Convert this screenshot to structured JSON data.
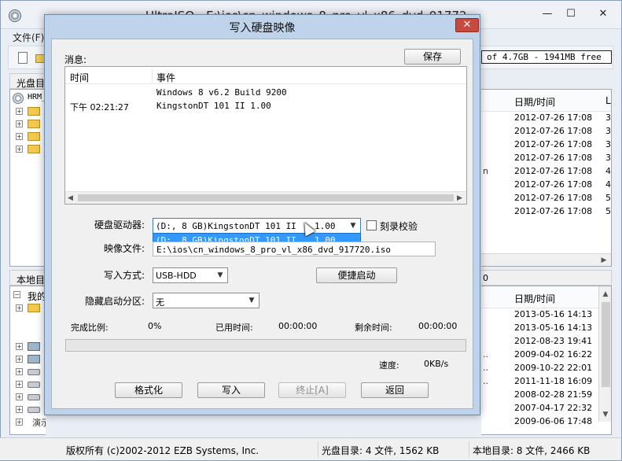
{
  "main_window": {
    "title": "UltraISO - E:\\ios\\cn_windows_8_pro_vl_x86_dvd_917720.iso",
    "min_glyph": "—",
    "max_glyph": "☐",
    "close_glyph": "✕",
    "menu": {
      "file": "文件(F)"
    },
    "capacity_text": "of 4.7GB - 1941MB free",
    "disc_tree_header": "光盘目",
    "disc_tree_root": "HRM_",
    "local_tree_header": "本地目",
    "local_tree_root": "我的",
    "local_tree_tail": "演示(S:)",
    "local_capacity": "0",
    "disc_list": {
      "date_header": "日期/时间",
      "col2_header": "L",
      "rows": [
        {
          "pre": "",
          "date": "2012-07-26 17:08",
          "mark": "3"
        },
        {
          "pre": "",
          "date": "2012-07-26 17:08",
          "mark": "3"
        },
        {
          "pre": "",
          "date": "2012-07-26 17:08",
          "mark": "3"
        },
        {
          "pre": "",
          "date": "2012-07-26 17:08",
          "mark": "3"
        },
        {
          "pre": "n",
          "date": "2012-07-26 17:08",
          "mark": "4"
        },
        {
          "pre": "",
          "date": "2012-07-26 17:08",
          "mark": "4"
        },
        {
          "pre": "",
          "date": "2012-07-26 17:08",
          "mark": "5"
        },
        {
          "pre": "",
          "date": "2012-07-26 17:08",
          "mark": "5"
        }
      ]
    },
    "local_list": {
      "date_header": "日期/时间",
      "rows": [
        {
          "pre": "",
          "date": "2013-05-16 14:13"
        },
        {
          "pre": "",
          "date": "2013-05-16 14:13"
        },
        {
          "pre": "",
          "date": "2012-08-23 19:41"
        },
        {
          "pre": "..",
          "date": "2009-04-02 16:22"
        },
        {
          "pre": "..",
          "date": "2009-10-22 22:01"
        },
        {
          "pre": "..",
          "date": "2011-11-18 16:09"
        },
        {
          "pre": "",
          "date": "2008-02-28 21:59"
        },
        {
          "pre": "",
          "date": "2007-04-17 22:32"
        },
        {
          "pre": "",
          "date": "2009-06-06 17:48"
        }
      ]
    },
    "status": {
      "copyright": "版权所有 (c)2002-2012 EZB Systems, Inc.",
      "disc": "光盘目录: 4 文件, 1562 KB",
      "local": "本地目录: 8 文件, 2466 KB"
    }
  },
  "dialog": {
    "title": "写入硬盘映像",
    "close_glyph": "✕",
    "messages_label": "消息:",
    "save_label": "保存",
    "log": {
      "time_header": "时间",
      "event_header": "事件",
      "entries": [
        {
          "time": "",
          "event": "Windows 8 v6.2 Build 9200"
        },
        {
          "time": "下午 02:21:27",
          "event": "KingstonDT 101 II       1.00"
        }
      ]
    },
    "drive_label": "硬盘驱动器:",
    "drive_selected": "(D:, 8 GB)KingstonDT 101 II",
    "drive_selected_rev": "1.00",
    "drive_options": [
      {
        "name": "(D:, 8 GB)KingstonDT 101 II",
        "rev": "1.00"
      }
    ],
    "verify_label": "刻录校验",
    "image_label": "映像文件:",
    "image_path": "E:\\ios\\cn_windows_8_pro_vl_x86_dvd_917720.iso",
    "method_label": "写入方式:",
    "method_value": "USB-HDD",
    "quick_boot_label": "便捷启动",
    "hidden_label": "隐藏启动分区:",
    "hidden_value": "无",
    "done_label": "完成比例:",
    "done_value": "0%",
    "progress_fraction": 0,
    "elapsed_label": "已用时间:",
    "elapsed_value": "00:00:00",
    "remain_label": "剩余时间:",
    "remain_value": "00:00:00",
    "speed_label": "速度:",
    "speed_value": "0KB/s",
    "format_label": "格式化",
    "write_label": "写入",
    "stop_label": "终止[A]",
    "back_label": "返回"
  },
  "colors": {
    "dialog_frame": "#bfd3ea",
    "close_red": "#c64a3d",
    "selection": "#3399ff",
    "progress_green": "#06b025"
  },
  "icons": [
    "app-disc-icon",
    "new-doc-icon",
    "open-folder-icon",
    "cd-icon",
    "folder-icon",
    "drive-icon",
    "cursor-icon"
  ]
}
